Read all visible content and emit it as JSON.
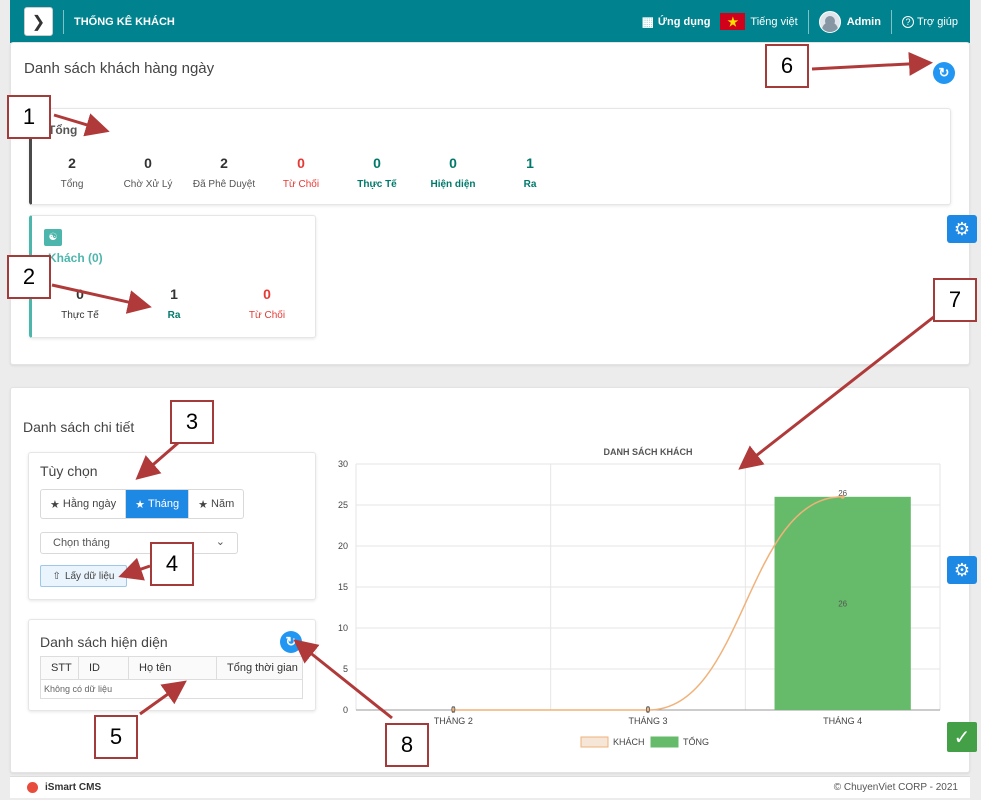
{
  "header": {
    "title": "THỐNG KÊ KHÁCH",
    "apps_label": "Ứng dụng",
    "language_label": "Tiếng việt",
    "user_label": "Admin",
    "help_label": "Trợ giúp"
  },
  "daily": {
    "title": "Danh sách khách hàng ngày",
    "summary_title": "Tổng",
    "summary": [
      {
        "value": "2",
        "label": "Tổng",
        "color": "#333333"
      },
      {
        "value": "0",
        "label": "Chờ Xử Lý",
        "color": "#333333"
      },
      {
        "value": "2",
        "label": "Đã Phê Duyệt",
        "color": "#333333"
      },
      {
        "value": "0",
        "label": "Từ Chối",
        "color": "#e53935"
      },
      {
        "value": "0",
        "label": "Thực Tế",
        "color": "#00796b"
      },
      {
        "value": "0",
        "label": "Hiện diện",
        "color": "#00796b"
      },
      {
        "value": "1",
        "label": "Ra",
        "color": "#00796b"
      }
    ],
    "guest_title": "Khách (0)",
    "guest": [
      {
        "value": "0",
        "label": "Thực Tế"
      },
      {
        "value": "1",
        "label": "Ra"
      },
      {
        "value": "0",
        "label": "Từ Chối"
      }
    ]
  },
  "detail": {
    "title": "Danh sách chi tiết",
    "options_title": "Tùy chọn",
    "periods": [
      "Hằng ngày",
      "Tháng",
      "Năm"
    ],
    "active_period": "Tháng",
    "month_select_placeholder": "Chọn tháng",
    "get_data_label": "Lấy dữ liệu",
    "presence_title": "Danh sách hiện diện",
    "table_headers": [
      "STT",
      "ID",
      "Họ tên",
      "Tổng thời gian"
    ],
    "empty_text": "Không có dữ liệu"
  },
  "chart_data": {
    "type": "bar",
    "title": "DANH SÁCH KHÁCH",
    "categories": [
      "THÁNG 2",
      "THÁNG 3",
      "THÁNG 4"
    ],
    "series": [
      {
        "name": "KHÁCH",
        "type": "line",
        "values": [
          0,
          0,
          26
        ],
        "color": "#f0b27a"
      },
      {
        "name": "TỔNG",
        "type": "bar",
        "values": [
          0,
          0,
          26
        ],
        "color": "#66bb6a"
      }
    ],
    "ylim": [
      0,
      30
    ],
    "yticks": [
      0,
      5,
      10,
      15,
      20,
      25,
      30
    ],
    "legend": "bottom",
    "grid": true
  },
  "annotations": [
    "1",
    "2",
    "3",
    "4",
    "5",
    "6",
    "7",
    "8"
  ],
  "footer": {
    "brand": "iSmart CMS",
    "copyright": "© ChuyenViet CORP - 2021"
  },
  "colors": {
    "topbar": "#00838f",
    "primary": "#1e88e5",
    "annotation": "#a33b3b"
  }
}
